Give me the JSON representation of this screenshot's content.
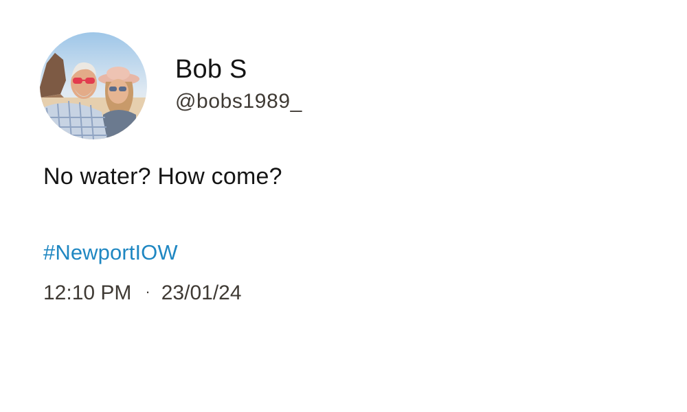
{
  "post": {
    "author": {
      "display_name": "Bob S",
      "handle": "@bobs1989_",
      "avatar_icon": "profile-photo"
    },
    "text": "No water? How come?",
    "hashtag": "#NewportIOW",
    "time": "12:10 PM",
    "separator": "·",
    "date": "23/01/24"
  },
  "colors": {
    "hashtag": "#1f87c2",
    "meta_text": "#3f3a34",
    "primary_text": "#141414",
    "background": "#ffffff"
  }
}
